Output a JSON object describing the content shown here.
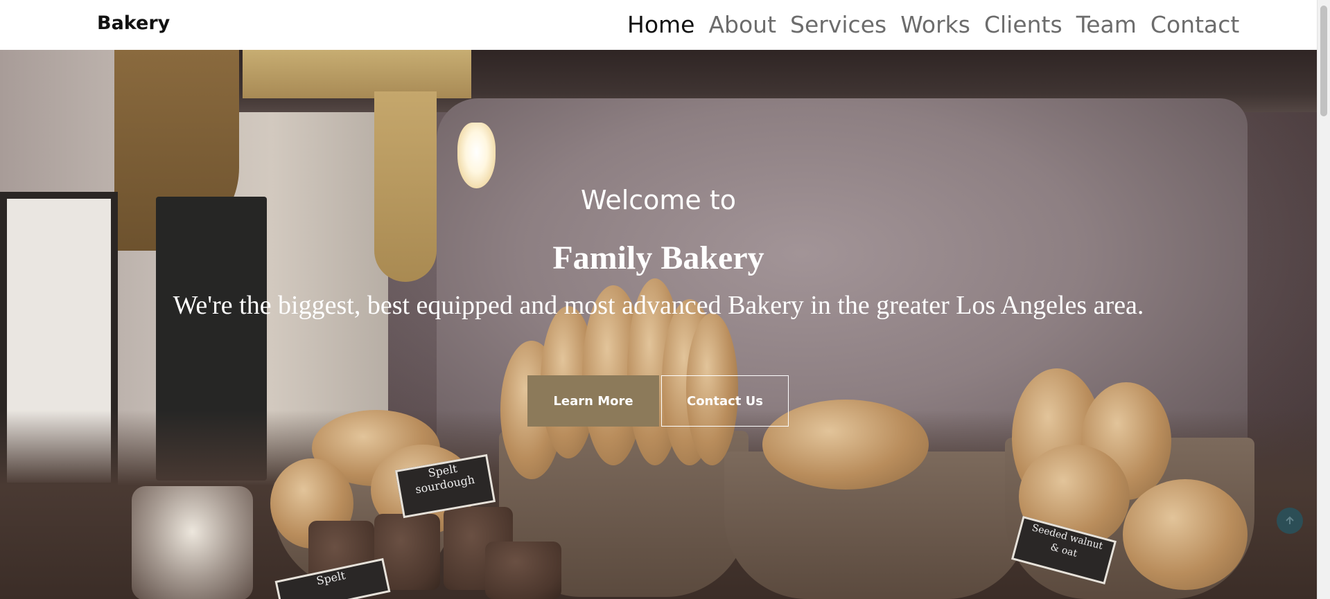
{
  "navbar": {
    "brand": "Bakery",
    "links": [
      "Home",
      "About",
      "Services",
      "Works",
      "Clients",
      "Team",
      "Contact"
    ],
    "active": "Home"
  },
  "hero": {
    "welcome": "Welcome to",
    "company": "Family Bakery",
    "tagline": "We're the biggest, best equipped and most advanced Bakery in the greater Los Angeles area.",
    "learn_more_label": "Learn More",
    "contact_label": "Contact Us",
    "accent_color": "#8c7a5a"
  },
  "scene_signs": {
    "sign1": "Spelt\nsourdough",
    "sign2": "Spelt",
    "sign3": "Seeded walnut\n& oat"
  },
  "icons": {
    "back_to_top": "arrow-up-icon"
  }
}
